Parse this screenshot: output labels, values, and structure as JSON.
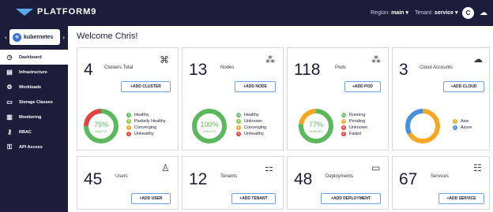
{
  "header": {
    "logo_text": "PLATFORM9",
    "region_label": "Region: ",
    "region_value": "main ▾",
    "tenant_label": "Tenant: ",
    "tenant_value": "service ▾",
    "avatar_initial": "C"
  },
  "sidebar": {
    "cluster": "kubernetes",
    "items": [
      {
        "label": "Dashboard",
        "icon": "◷"
      },
      {
        "label": "Infrastructure",
        "icon": "▤"
      },
      {
        "label": "Workloads",
        "icon": "⚙"
      },
      {
        "label": "Storage Classes",
        "icon": "▭"
      },
      {
        "label": "Monitoring",
        "icon": "▥"
      },
      {
        "label": "RBAC",
        "icon": "⚷"
      },
      {
        "label": "API Access",
        "icon": "⚿"
      }
    ]
  },
  "welcome": "Welcome Chris!",
  "cards": {
    "clusters": {
      "count": "4",
      "label": "Clusters Total",
      "button": "+ADD CLUSTER",
      "donut_pct": "75%",
      "donut_sub": "HEALTHY",
      "legend": [
        {
          "n": "3",
          "label": "Healthy",
          "color": "#5cb85c"
        },
        {
          "n": "0",
          "label": "Partially Healthy",
          "color": "#8dc63f"
        },
        {
          "n": "0",
          "label": "Converging",
          "color": "#f5a623"
        },
        {
          "n": "1",
          "label": "Unhealthy",
          "color": "#e0443e"
        }
      ]
    },
    "nodes": {
      "count": "13",
      "label": "Nodes",
      "button": "+ADD NODE",
      "donut_pct": "100%",
      "donut_sub": "HEALTHY",
      "legend": [
        {
          "n": "13",
          "label": "Healthy",
          "color": "#5cb85c"
        },
        {
          "n": "0",
          "label": "Unknown",
          "color": "#8dc63f"
        },
        {
          "n": "0",
          "label": "Converging",
          "color": "#f5a623"
        },
        {
          "n": "0",
          "label": "Unhealthy",
          "color": "#e0443e"
        }
      ]
    },
    "pods": {
      "count": "118",
      "label": "Pods",
      "button": "+ADD POD",
      "donut_pct": "77%",
      "donut_sub": "RUNNING",
      "legend": [
        {
          "n": "91",
          "label": "Running",
          "color": "#5cb85c"
        },
        {
          "n": "27",
          "label": "Pending",
          "color": "#f5a623"
        },
        {
          "n": "0",
          "label": "Unknown",
          "color": "#e0443e"
        },
        {
          "n": "0",
          "label": "Failed",
          "color": "#e0443e"
        }
      ]
    },
    "cloud": {
      "count": "3",
      "label": "Cloud Accounts",
      "button": "+ADD CLOUD",
      "legend": [
        {
          "n": "2",
          "label": "Aws",
          "color": "#f5a623"
        },
        {
          "n": "1",
          "label": "Azure",
          "color": "#4a90d9"
        }
      ]
    },
    "users": {
      "count": "45",
      "label": "Users",
      "button": "+ADD USER"
    },
    "tenants": {
      "count": "12",
      "label": "Tenants",
      "button": "+ADD TENANT"
    },
    "deployments": {
      "count": "48",
      "label": "Deployments",
      "button": "+ADD DEPLOYMENT"
    },
    "services": {
      "count": "67",
      "label": "Services",
      "button": "+ADD SERVICE"
    }
  },
  "colors": {
    "header_bg": "#1c1d3a",
    "healthy": "#5cb85c",
    "warning": "#f5a623",
    "danger": "#e0443e",
    "info": "#4a90d9"
  }
}
